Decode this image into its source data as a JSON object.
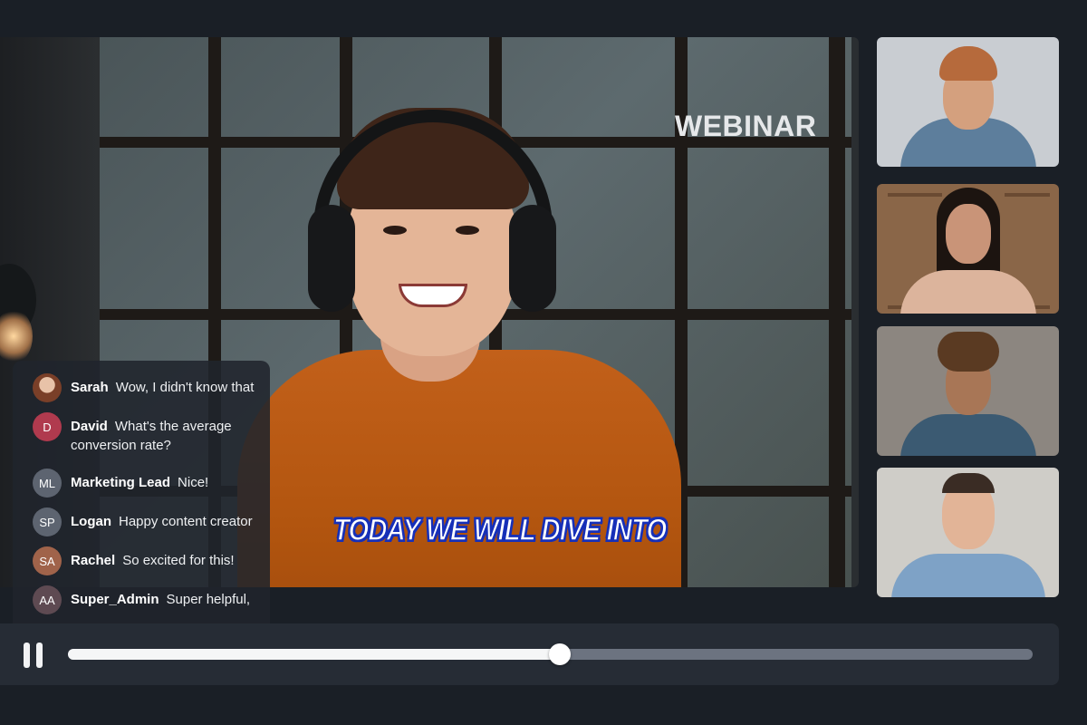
{
  "overlay": {
    "webinar_label": "WEBINAR",
    "caption": "TODAY WE WILL DIVE INTO"
  },
  "chat": {
    "messages": [
      {
        "name": "Sarah",
        "text": "Wow, I didn't know that",
        "avatar_text": "",
        "avatar_color": "#b06b52",
        "avatar_type": "photo"
      },
      {
        "name": "David",
        "text": "What's the average conversion rate?",
        "avatar_text": "D",
        "avatar_color": "#b03a4e",
        "avatar_type": "initials"
      },
      {
        "name": "Marketing Lead",
        "text": "Nice!",
        "avatar_text": "ML",
        "avatar_color": "#5d6470",
        "avatar_type": "initials"
      },
      {
        "name": "Logan",
        "text": "Happy content creator",
        "avatar_text": "SP",
        "avatar_color": "#5d6470",
        "avatar_type": "initials"
      },
      {
        "name": "Rachel",
        "text": "So excited for this!",
        "avatar_text": "SA",
        "avatar_color": "#a0634a",
        "avatar_type": "initials"
      },
      {
        "name": "Super_Admin",
        "text": "Super helpful,",
        "avatar_text": "AA",
        "avatar_color": "#5e4a52",
        "avatar_type": "initials"
      }
    ]
  },
  "participants": [
    {
      "id": "participant-1",
      "description": "man-with-beanie",
      "bg": "#c9cdd2"
    },
    {
      "id": "participant-2",
      "description": "woman-bookshelf",
      "bg": "#8a6648"
    },
    {
      "id": "participant-3",
      "description": "man-curly-hair",
      "bg": "#8c8680"
    },
    {
      "id": "participant-4",
      "description": "man-blue-shirt",
      "bg": "#cfcdc8"
    }
  ],
  "player": {
    "state": "playing",
    "progress": 0.51,
    "pause_icon": "pause-icon"
  },
  "colors": {
    "background": "#1a1f26",
    "controls_bg": "#262c35",
    "track": "#6c7380",
    "caption_outline": "#1730b8"
  }
}
